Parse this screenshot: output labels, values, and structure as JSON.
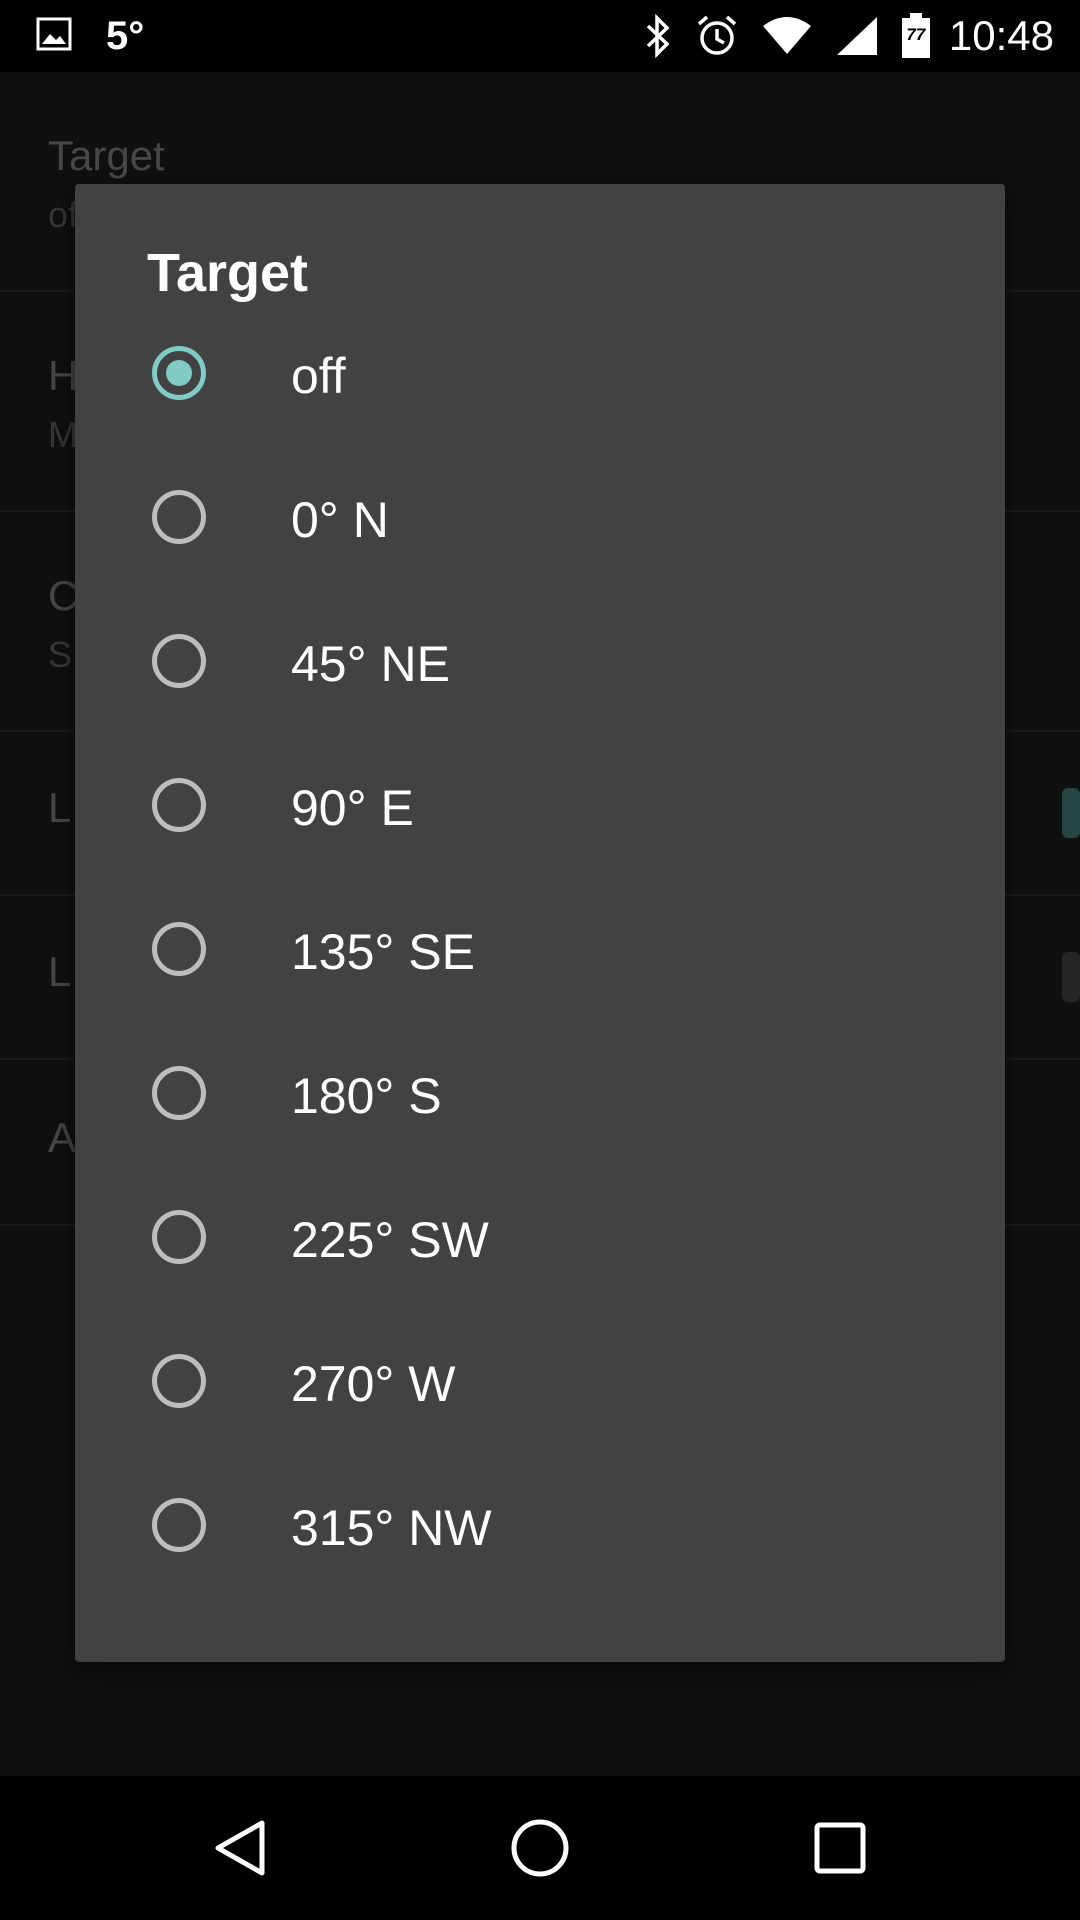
{
  "status_bar": {
    "temperature": "5°",
    "time": "10:48",
    "battery_level": "77",
    "icons": [
      "image-icon",
      "bluetooth-icon",
      "alarm-icon",
      "wifi-icon",
      "cell-signal-icon",
      "battery-icon"
    ]
  },
  "background": {
    "items": [
      {
        "title": "Target",
        "subtitle": "of"
      },
      {
        "title": "H",
        "subtitle": "M"
      },
      {
        "title": "C",
        "subtitle": "S"
      },
      {
        "title": "L",
        "subtitle": ""
      },
      {
        "title": "L",
        "subtitle": ""
      },
      {
        "title": "A",
        "subtitle": ""
      }
    ]
  },
  "dialog": {
    "title": "Target",
    "selected_index": 0,
    "options": [
      {
        "label": "off"
      },
      {
        "label": "0° N"
      },
      {
        "label": "45° NE"
      },
      {
        "label": "90° E"
      },
      {
        "label": "135° SE"
      },
      {
        "label": "180° S"
      },
      {
        "label": "225° SW"
      },
      {
        "label": "270° W"
      },
      {
        "label": "315° NW"
      }
    ]
  },
  "colors": {
    "accent": "#80cbc4",
    "dialog_bg": "#424242",
    "radio_unchecked": "#bdbdbd"
  },
  "nav": {
    "icons": [
      "back-icon",
      "home-icon",
      "recents-icon"
    ]
  }
}
